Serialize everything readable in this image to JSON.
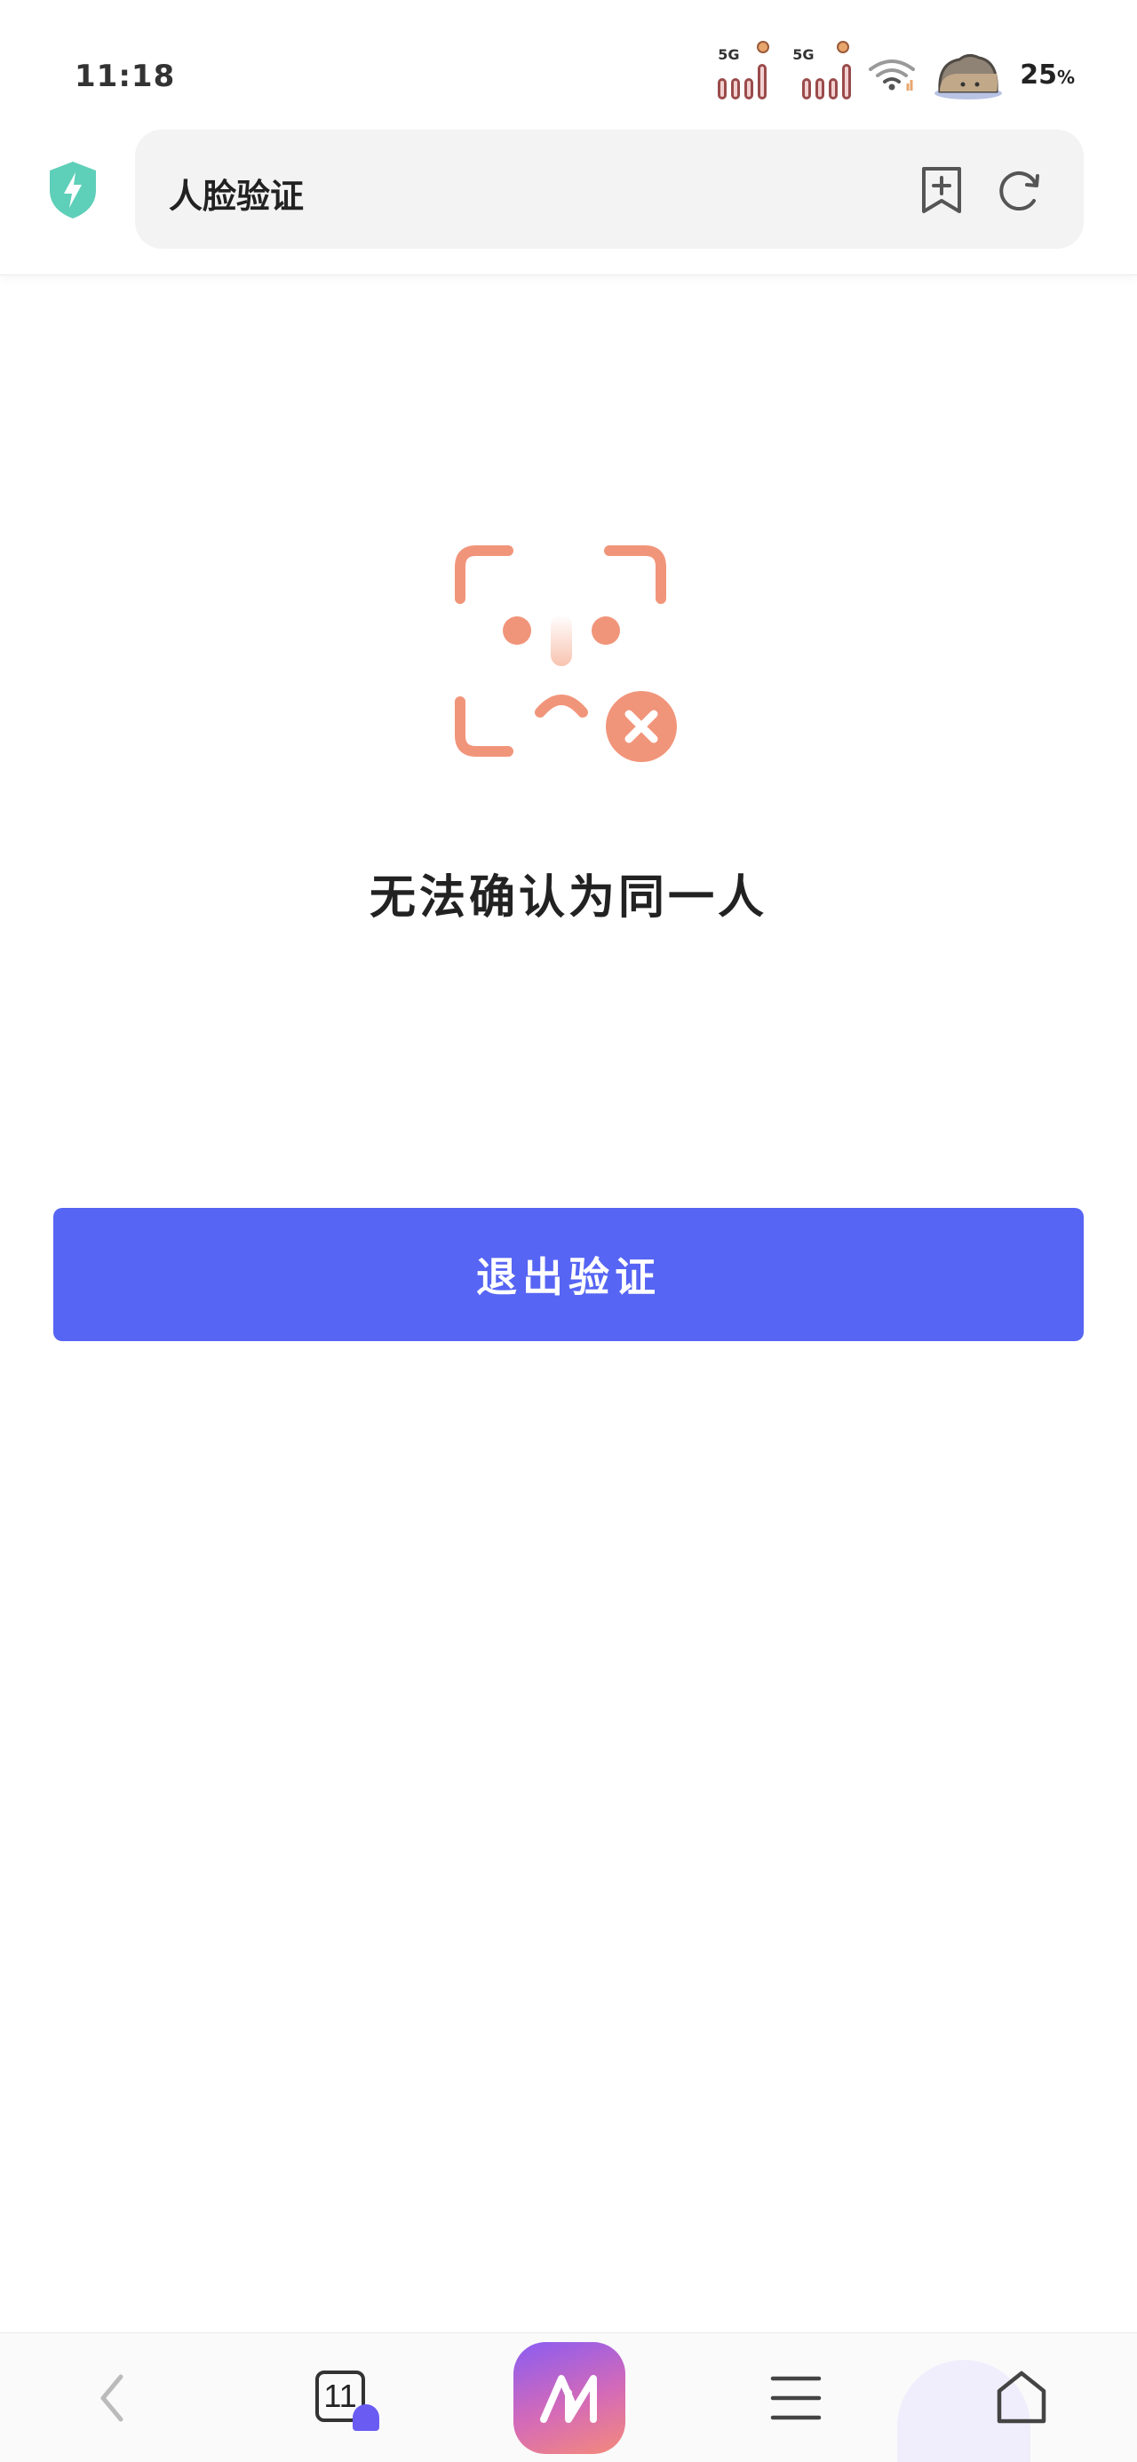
{
  "status_bar": {
    "time": "11:18",
    "sim1_label": "5G",
    "sim2_label": "5G",
    "battery_value": "25",
    "battery_unit": "%"
  },
  "browser": {
    "page_title": "人脸验证",
    "shield_color": "#5ecfb9"
  },
  "main": {
    "result_message": "无法确认为同一人",
    "exit_button_label": "退出验证",
    "accent_color": "#5665f3",
    "illustration_color": "#f1957a"
  },
  "bottom_nav": {
    "tab_count": "11",
    "items": [
      "back-icon",
      "tabs-icon",
      "ai-assistant-icon",
      "menu-icon",
      "home-icon"
    ]
  }
}
